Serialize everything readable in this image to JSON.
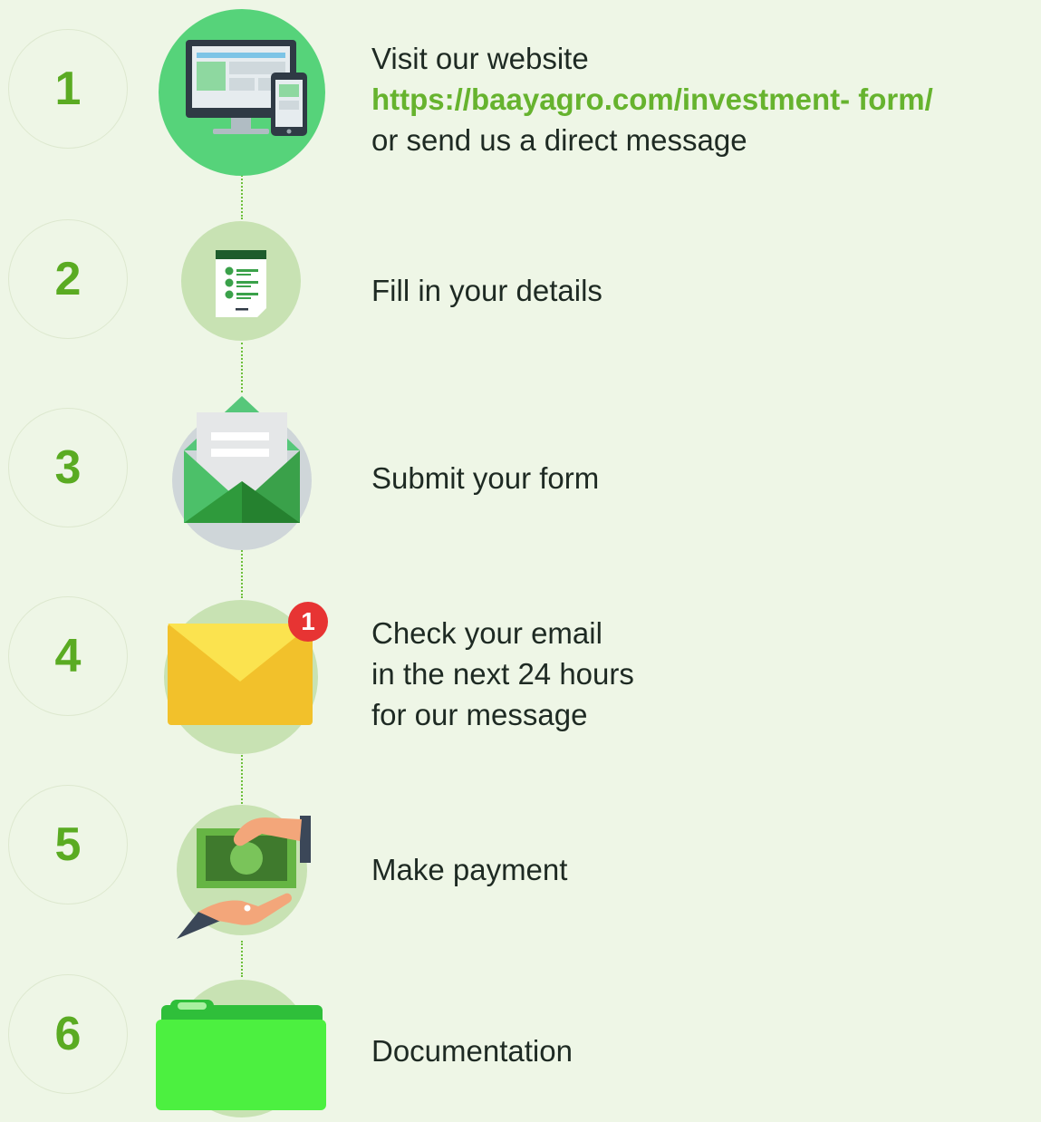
{
  "steps": [
    {
      "number": "1",
      "lines": [
        "Visit our website",
        "https://baayagro.com/investment- form/",
        "or send us a direct message"
      ],
      "icon": "website-devices-icon"
    },
    {
      "number": "2",
      "lines": [
        "Fill in your details"
      ],
      "icon": "checklist-form-icon"
    },
    {
      "number": "3",
      "lines": [
        "Submit your form"
      ],
      "icon": "open-envelope-icon"
    },
    {
      "number": "4",
      "lines": [
        "Check your email",
        "in the next 24 hours",
        "for our message"
      ],
      "icon": "email-notification-icon",
      "badge": "1"
    },
    {
      "number": "5",
      "lines": [
        "Make payment"
      ],
      "icon": "cash-payment-icon"
    },
    {
      "number": "6",
      "lines": [
        "Documentation"
      ],
      "icon": "folder-icon"
    }
  ],
  "colors": {
    "accent": "#5aab22",
    "link": "#66b32e",
    "background": "#eef6e6",
    "text": "#1e2a23"
  }
}
